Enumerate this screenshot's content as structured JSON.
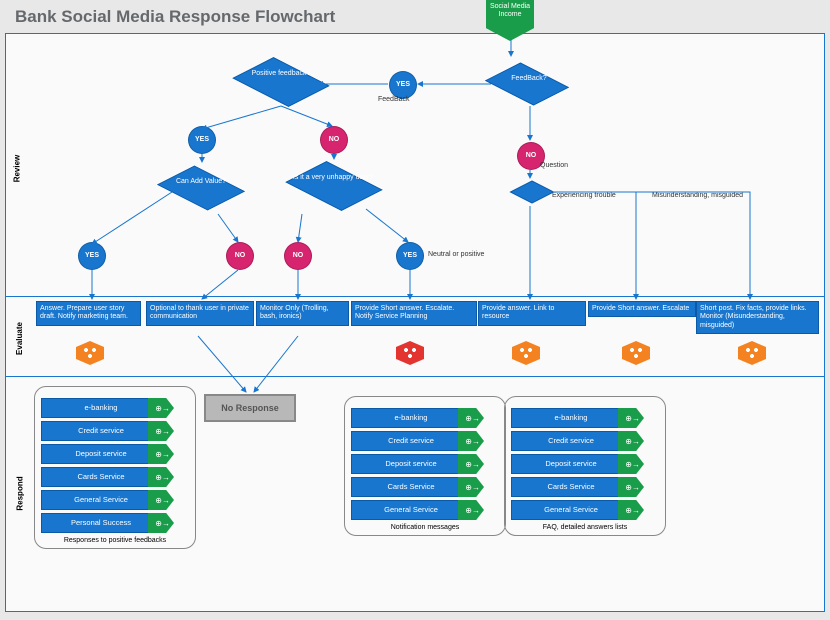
{
  "title": "Bank Social Media Response Flowchart",
  "lanes": {
    "review": "Review",
    "evaluate": "Evaluate",
    "respond": "Respond"
  },
  "start": "Social Media Income",
  "decisions": {
    "feedback": "FeedBack?",
    "positive": "Positive feedback?",
    "addvalue": "Can Add Value?",
    "unhappy": "Is it a very unhappy user?",
    "question_small": ""
  },
  "yesno": {
    "yes": "YES",
    "no": "NO"
  },
  "edge_labels": {
    "feedback": "FeedBack",
    "question": "Question",
    "experiencing": "Experiencing trouble",
    "misunderstanding": "Misunderstanding, misguided",
    "neutral": "Neutral or positive"
  },
  "evaluate": {
    "e1": "Answer.\nPrepare user story draft.\nNotify marketing team.",
    "e2": "Optional to thank user in private communication",
    "e3": "Monitor Only\n(Trolling, bash, ironics)",
    "e4": "Provide Short answer.\nEscalate.\nNotify Service Planning",
    "e5": "Provide answer.\nLink to resource",
    "e6": "Provide Short answer.\nEscalate",
    "e7": "Short post. Fix facts, provide links.\nMonitor (Misunderstanding, misguided)"
  },
  "noresponse": "No Response",
  "groups": {
    "g1": {
      "title": "Responses to positive feedbacks",
      "items": [
        "e-banking",
        "Credit service",
        "Deposit service",
        "Cards Service",
        "General Service",
        "Personal Success"
      ]
    },
    "g2": {
      "title": "Notification messages",
      "items": [
        "e-banking",
        "Credit service",
        "Deposit service",
        "Cards Service",
        "General Service"
      ]
    },
    "g3": {
      "title": "FAQ, detailed answers lists",
      "items": [
        "e-banking",
        "Credit service",
        "Deposit service",
        "Cards Service",
        "General Service"
      ]
    }
  }
}
